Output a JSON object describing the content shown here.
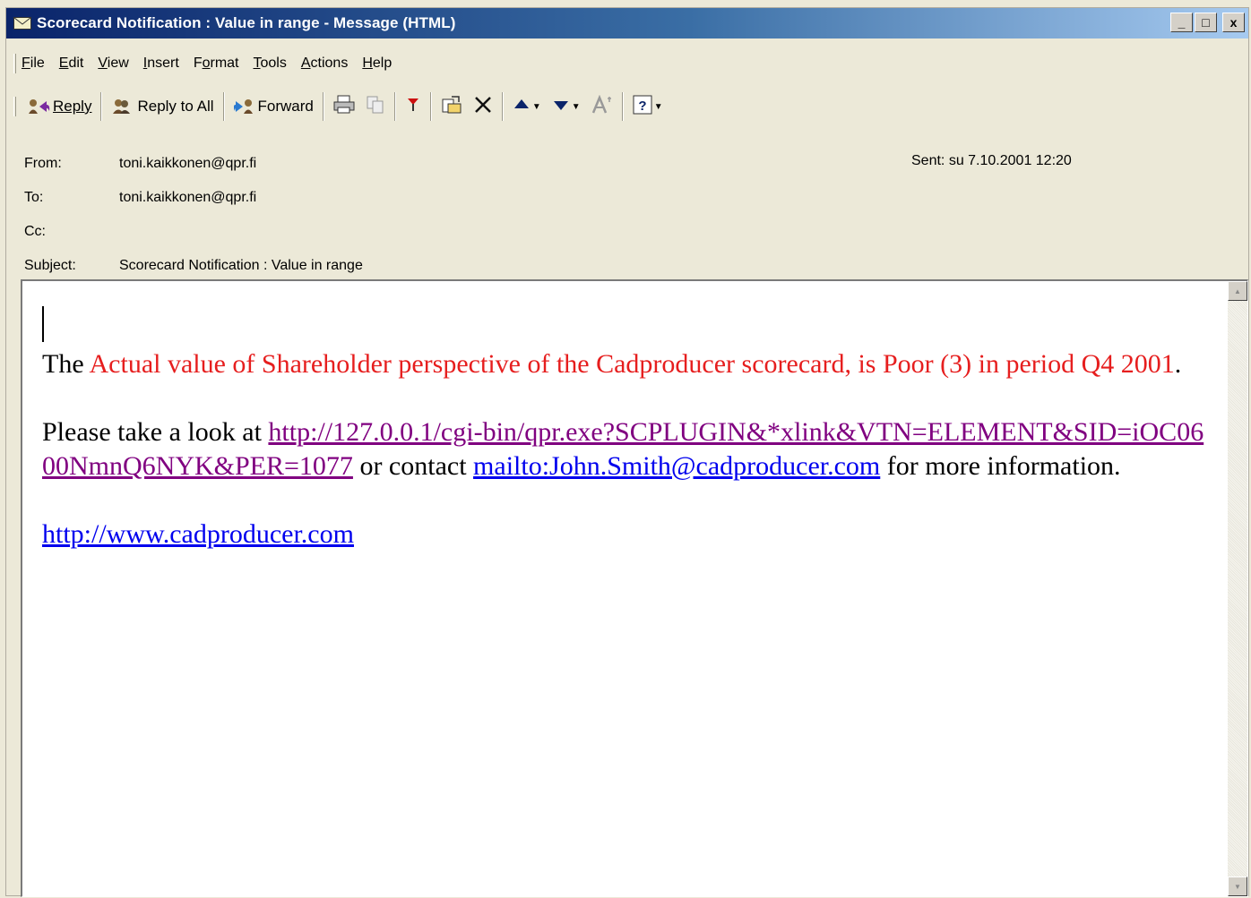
{
  "window": {
    "title": "Scorecard Notification : Value in range - Message (HTML)",
    "controls": [
      "_",
      "□",
      "x"
    ]
  },
  "menu": [
    {
      "pre": "",
      "u": "F",
      "post": "ile"
    },
    {
      "pre": "",
      "u": "E",
      "post": "dit"
    },
    {
      "pre": "",
      "u": "V",
      "post": "iew"
    },
    {
      "pre": "",
      "u": "I",
      "post": "nsert"
    },
    {
      "pre": "F",
      "u": "o",
      "post": "rmat"
    },
    {
      "pre": "",
      "u": "T",
      "post": "ools"
    },
    {
      "pre": "",
      "u": "A",
      "post": "ctions"
    },
    {
      "pre": "",
      "u": "H",
      "post": "elp"
    }
  ],
  "toolbar": {
    "reply": "Reply",
    "reply_all": "Reply to All",
    "forward": "Forward"
  },
  "headers": {
    "from_label": "From:",
    "from": "toni.kaikkonen@qpr.fi",
    "to_label": "To:",
    "to": "toni.kaikkonen@qpr.fi",
    "cc_label": "Cc:",
    "cc": "",
    "subject_label": "Subject:",
    "subject": "Scorecard Notification : Value in range",
    "sent_label": "Sent:",
    "sent": "su 7.10.2001 12:20"
  },
  "message": {
    "p1_prefix": "The ",
    "p1_highlight": "Actual value of Shareholder perspective of the Cadproducer scorecard, is Poor (3) in period Q4 2001",
    "p1_suffix": ".",
    "p2_prefix": "Please take a look at ",
    "p2_link1": "http://127.0.0.1/cgi-bin/qpr.exe?SCPLUGIN&*xlink&VTN=ELEMENT&SID=iOC0600NmnQ6NYK&PER=1077",
    "p2_mid": " or contact ",
    "p2_link2": "mailto:John.Smith@cadproducer.com",
    "p2_suffix": " for more information.",
    "p3_link": "http://www.cadproducer.com"
  },
  "colors": {
    "highlight": "#e61e1e",
    "visited_link": "#800080",
    "link": "#0000ee"
  }
}
